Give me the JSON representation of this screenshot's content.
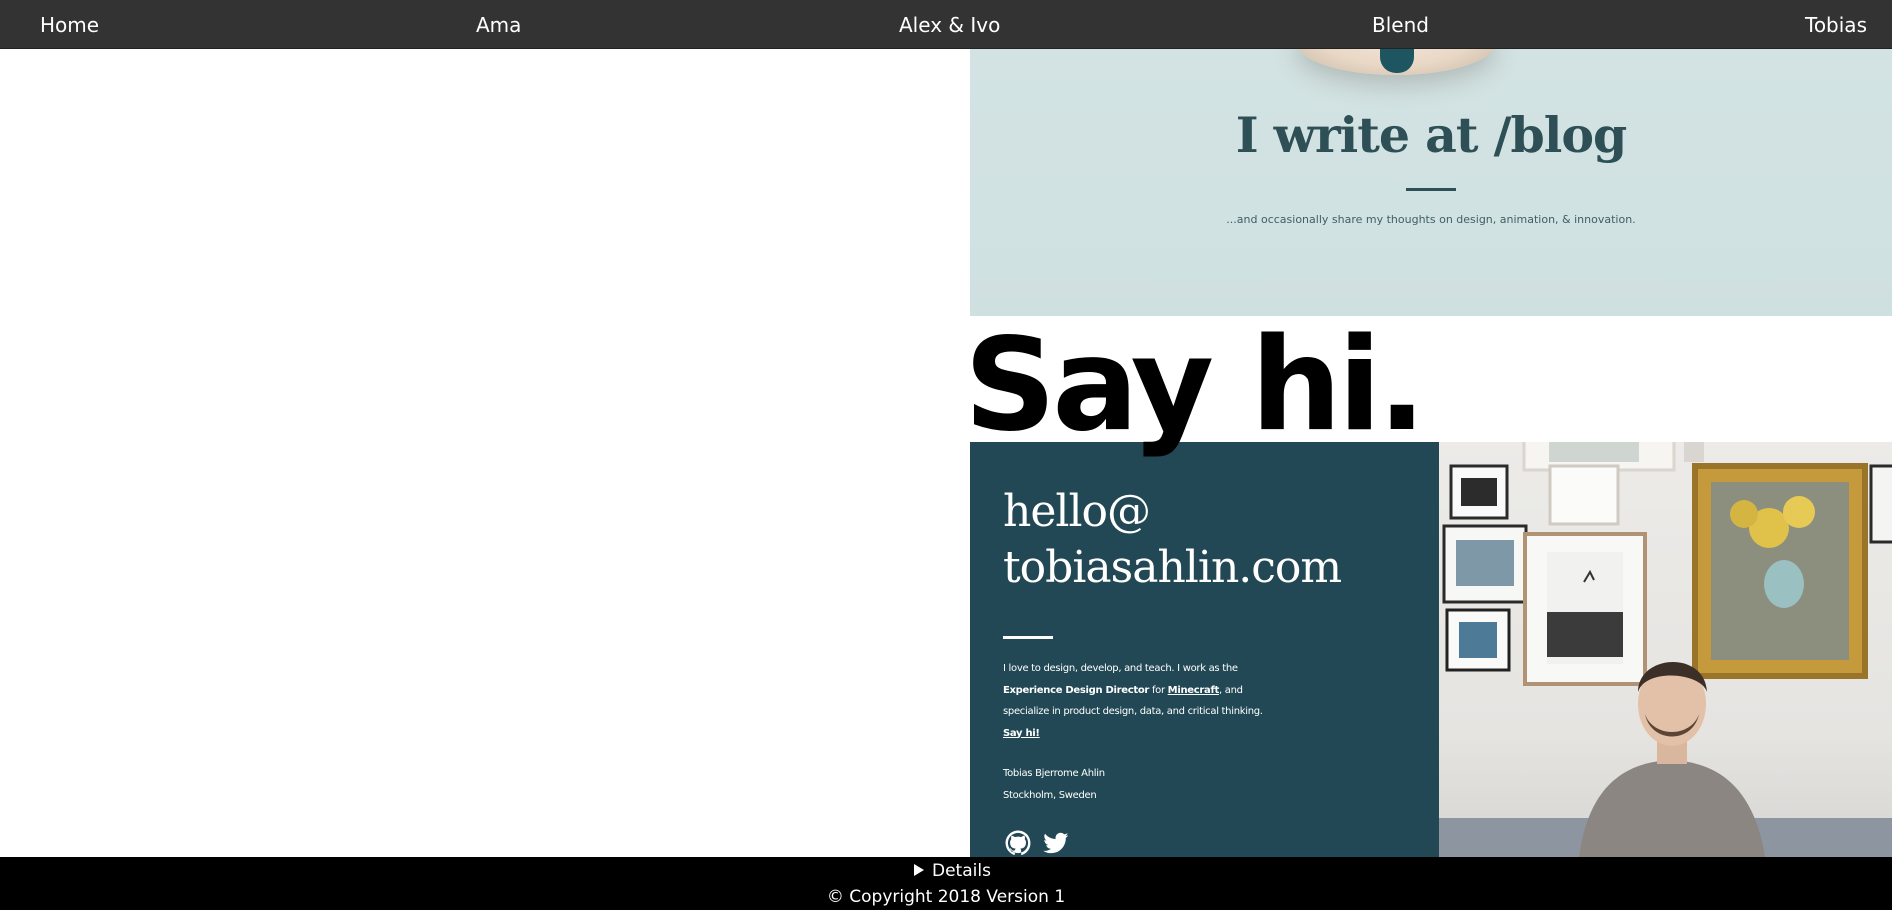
{
  "nav": {
    "items": [
      {
        "label": "Home"
      },
      {
        "label": "Ama"
      },
      {
        "label": "Alex & Ivo"
      },
      {
        "label": "Blend"
      },
      {
        "label": "Tobias"
      }
    ]
  },
  "blog": {
    "title": "I write at /blog",
    "subtitle": "...and occasionally share my thoughts on design, animation, & innovation."
  },
  "contact": {
    "heading": "Say hi.",
    "email_line1": "hello@",
    "email_line2": "tobiasahlin.com",
    "bio_part1": "I love to design, develop, and teach. I work as the",
    "bio_role": "Experience Design Director",
    "bio_for": " for ",
    "bio_company": "Minecraft",
    "bio_part2": ", and",
    "bio_part3": "specialize in product design, data, and critical thinking.",
    "say_hi_link": "Say hi!",
    "name": "Tobias Bjerrome Ahlin",
    "location": "Stockholm, Sweden",
    "social": [
      "github-icon",
      "twitter-icon"
    ]
  },
  "footer": {
    "details_label": "Details",
    "copyright": "© Copyright 2018 Version 1"
  },
  "colors": {
    "nav_bg": "#333333",
    "blog_bg": "#d1e2e2",
    "contact_bg": "#214854",
    "footer_bg": "#000000"
  }
}
